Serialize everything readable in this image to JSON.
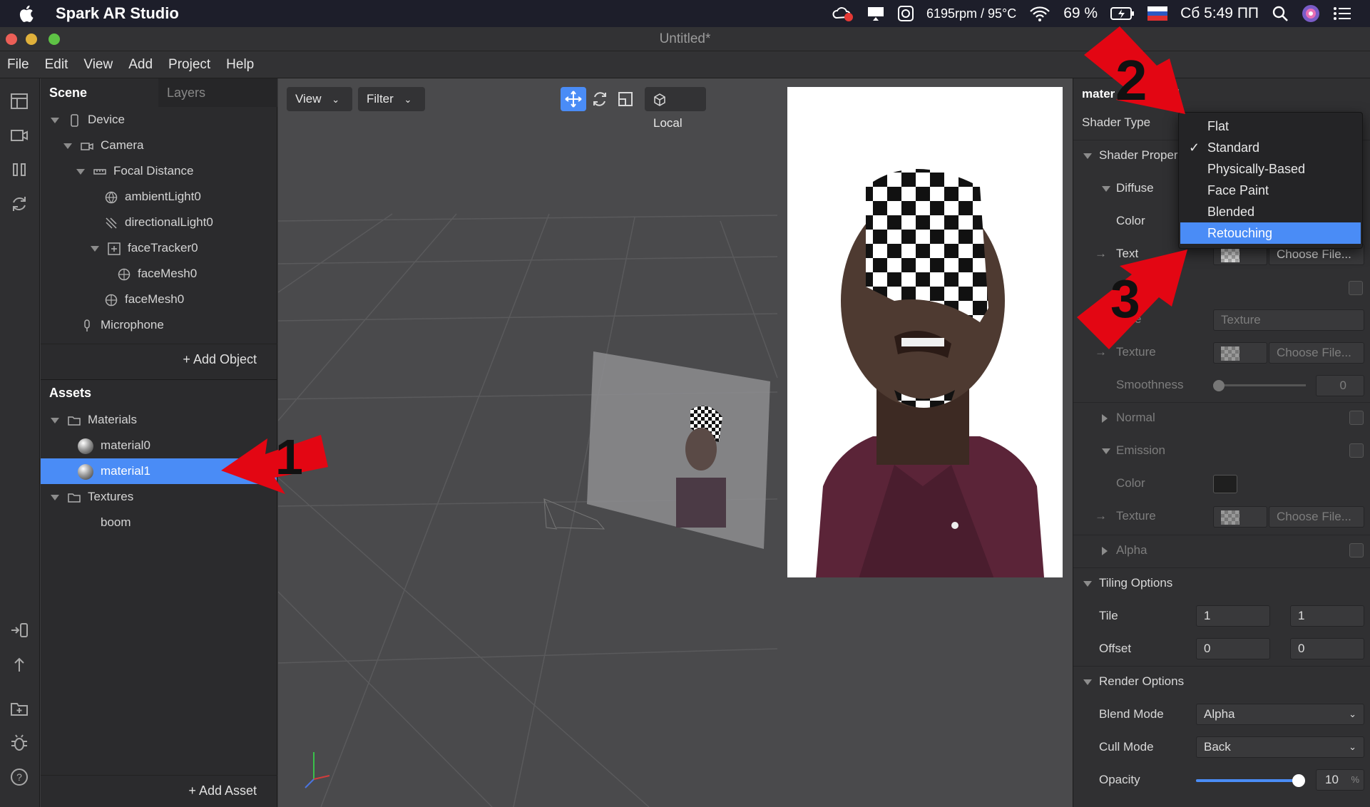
{
  "menubar": {
    "app_name": "Spark AR Studio",
    "fan_status": "6195rpm / 95°C",
    "battery": "69 %",
    "clock": "Сб 5:49 ПП"
  },
  "window": {
    "title": "Untitled*"
  },
  "app_menu": [
    "File",
    "Edit",
    "View",
    "Add",
    "Project",
    "Help"
  ],
  "scene": {
    "tabs": [
      "Scene",
      "Layers"
    ],
    "tree": [
      {
        "label": "Device",
        "icon": "device-icon"
      },
      {
        "label": "Camera",
        "icon": "camera-icon"
      },
      {
        "label": "Focal Distance",
        "icon": "ruler-icon"
      },
      {
        "label": "ambientLight0",
        "icon": "globe-icon"
      },
      {
        "label": "directionalLight0",
        "icon": "light-icon"
      },
      {
        "label": "faceTracker0",
        "icon": "face-tracker-icon"
      },
      {
        "label": "faceMesh0",
        "icon": "mesh-icon"
      },
      {
        "label": "faceMesh0",
        "icon": "mesh-icon"
      },
      {
        "label": "Microphone",
        "icon": "microphone-icon"
      }
    ],
    "add_object": "+ Add Object"
  },
  "assets": {
    "title": "Assets",
    "tree": [
      {
        "label": "Materials"
      },
      {
        "label": "material0"
      },
      {
        "label": "material1",
        "selected": true
      },
      {
        "label": "Textures"
      },
      {
        "label": "boom"
      }
    ],
    "add_asset": "+ Add Asset"
  },
  "viewport": {
    "view_label": "View",
    "filter_label": "Filter",
    "local_label": "Local"
  },
  "inspector": {
    "header": "material1  material",
    "header_left": "mater",
    "header_right": "terial",
    "shader_type_label": "Shader Type",
    "shader_properties": "Shader Proper",
    "diffuse": "Diffuse",
    "color": "Color",
    "texture_partial": "Text",
    "choose_file": "Choose File...",
    "texture_value": "Texture",
    "specular_label_partial": "e",
    "texture": "Texture",
    "smoothness": "Smoothness",
    "smoothness_value": "0",
    "normal": "Normal",
    "emission": "Emission",
    "alpha": "Alpha",
    "tiling_options": "Tiling Options",
    "tile": "Tile",
    "tile_x": "1",
    "tile_y": "1",
    "offset": "Offset",
    "offset_x": "0",
    "offset_y": "0",
    "render_options": "Render Options",
    "blend_mode": "Blend Mode",
    "blend_mode_value": "Alpha",
    "cull_mode": "Cull Mode",
    "cull_mode_value": "Back",
    "opacity": "Opacity",
    "opacity_value": "10",
    "percent": "%",
    "opacity_level": 0.95
  },
  "shader_dropdown": {
    "options": [
      "Flat",
      "Standard",
      "Physically-Based",
      "Face Paint",
      "Blended",
      "Retouching"
    ],
    "checked": "Standard",
    "highlighted": "Retouching"
  },
  "annotations": [
    "1",
    "2",
    "3"
  ],
  "colors": {
    "accent": "#4a8cf6",
    "arrow_red": "#e30613"
  }
}
